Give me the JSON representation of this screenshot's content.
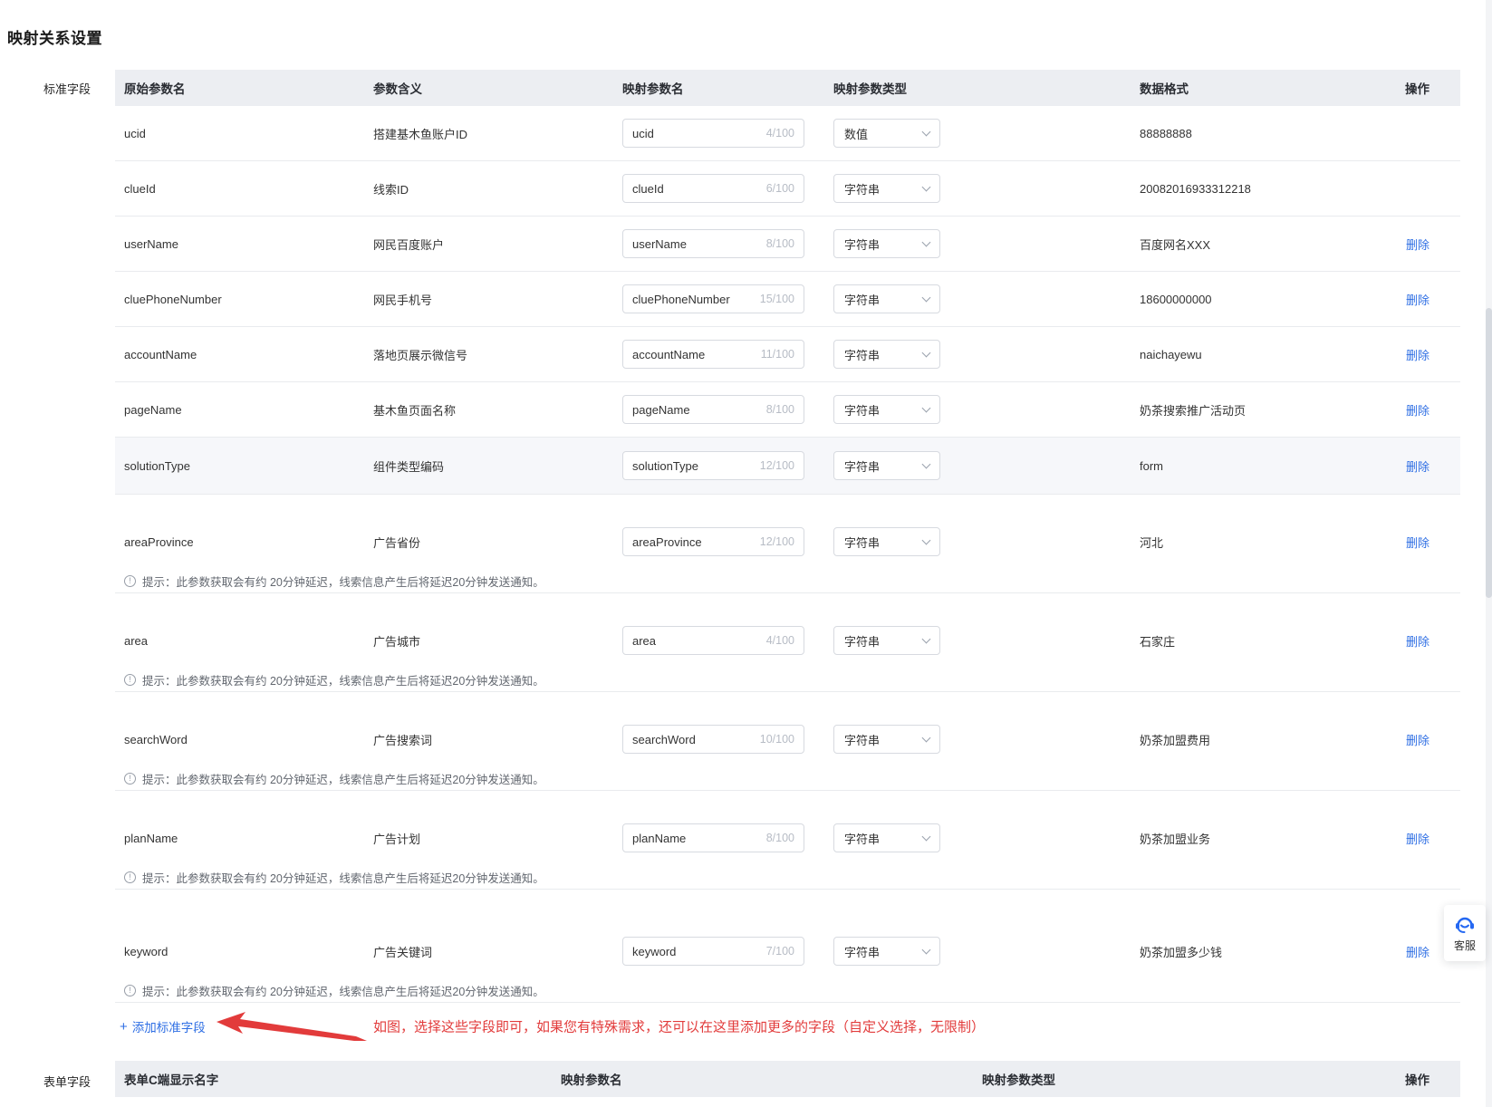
{
  "page": {
    "title": "映射关系设置"
  },
  "colors": {
    "accent_blue": "#2f6fe4",
    "annotation_red": "#e23b3b",
    "service_icon_blue": "#2468f2",
    "header_bg": "#eceef2",
    "highlight_row_bg": "#f6f7fa"
  },
  "sections": {
    "standard": {
      "gutter_label": "标准字段",
      "columns": [
        "原始参数名",
        "参数含义",
        "映射参数名",
        "映射参数类型",
        "数据格式",
        "操作"
      ],
      "delete_label": "删除",
      "hint": "提示：此参数获取会有约 20分钟延迟，线索信息产生后将延迟20分钟发送通知。",
      "add_label": "添加标准字段",
      "annotation": "如图，选择这些字段即可，如果您有特殊需求，还可以在这里添加更多的字段（自定义选择，无限制）",
      "rows": [
        {
          "name": "ucid",
          "meaning": "搭建基木鱼账户ID",
          "mapped": "ucid",
          "count": "4/100",
          "type": "数值",
          "format": "88888888",
          "deletable": false,
          "hint": false,
          "highlight": false
        },
        {
          "name": "clueId",
          "meaning": "线索ID",
          "mapped": "clueId",
          "count": "6/100",
          "type": "字符串",
          "format": "20082016933312218",
          "deletable": false,
          "hint": false,
          "highlight": false
        },
        {
          "name": "userName",
          "meaning": "网民百度账户",
          "mapped": "userName",
          "count": "8/100",
          "type": "字符串",
          "format": "百度网名XXX",
          "deletable": true,
          "hint": false,
          "highlight": false
        },
        {
          "name": "cluePhoneNumber",
          "meaning": "网民手机号",
          "mapped": "cluePhoneNumber",
          "count": "15/100",
          "type": "字符串",
          "format": "18600000000",
          "deletable": true,
          "hint": false,
          "highlight": false
        },
        {
          "name": "accountName",
          "meaning": "落地页展示微信号",
          "mapped": "accountName",
          "count": "11/100",
          "type": "字符串",
          "format": "naichayewu",
          "deletable": true,
          "hint": false,
          "highlight": false
        },
        {
          "name": "pageName",
          "meaning": "基木鱼页面名称",
          "mapped": "pageName",
          "count": "8/100",
          "type": "字符串",
          "format": "奶茶搜索推广活动页",
          "deletable": true,
          "hint": false,
          "highlight": false
        },
        {
          "name": "solutionType",
          "meaning": "组件类型编码",
          "mapped": "solutionType",
          "count": "12/100",
          "type": "字符串",
          "format": "form",
          "deletable": true,
          "hint": false,
          "highlight": true
        },
        {
          "name": "areaProvince",
          "meaning": "广告省份",
          "mapped": "areaProvince",
          "count": "12/100",
          "type": "字符串",
          "format": "河北",
          "deletable": true,
          "hint": true,
          "highlight": false
        },
        {
          "name": "area",
          "meaning": "广告城市",
          "mapped": "area",
          "count": "4/100",
          "type": "字符串",
          "format": "石家庄",
          "deletable": true,
          "hint": true,
          "highlight": false
        },
        {
          "name": "searchWord",
          "meaning": "广告搜索词",
          "mapped": "searchWord",
          "count": "10/100",
          "type": "字符串",
          "format": "奶茶加盟费用",
          "deletable": true,
          "hint": true,
          "highlight": false
        },
        {
          "name": "planName",
          "meaning": "广告计划",
          "mapped": "planName",
          "count": "8/100",
          "type": "字符串",
          "format": "奶茶加盟业务",
          "deletable": true,
          "hint": true,
          "highlight": false
        },
        {
          "name": "keyword",
          "meaning": "广告关键词",
          "mapped": "keyword",
          "count": "7/100",
          "type": "字符串",
          "format": "奶茶加盟多少钱",
          "deletable": true,
          "hint": true,
          "highlight": false
        }
      ]
    },
    "form": {
      "gutter_label": "表单字段",
      "columns": [
        "表单C端显示名字",
        "映射参数名",
        "映射参数类型",
        "操作"
      ]
    }
  },
  "floating": {
    "service_label": "客服"
  }
}
